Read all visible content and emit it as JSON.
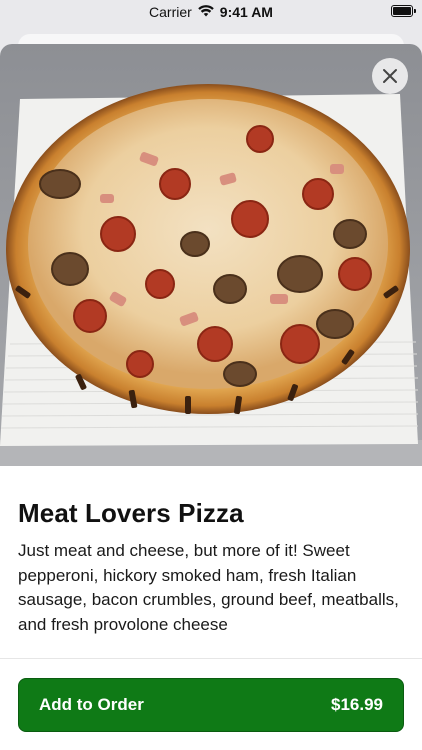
{
  "status_bar": {
    "carrier": "Carrier",
    "time": "9:41 AM"
  },
  "item": {
    "title": "Meat Lovers Pizza",
    "description": "Just meat and cheese, but more of it! Sweet pepperoni, hickory smoked ham, fresh Italian sausage, bacon crumbles, ground beef, meatballs, and fresh provolone cheese"
  },
  "cta": {
    "label": "Add to Order",
    "price": "$16.99"
  },
  "icons": {
    "wifi": "wifi-icon",
    "battery": "battery-icon",
    "close": "close-icon"
  },
  "colors": {
    "accent": "#0f7a16"
  }
}
